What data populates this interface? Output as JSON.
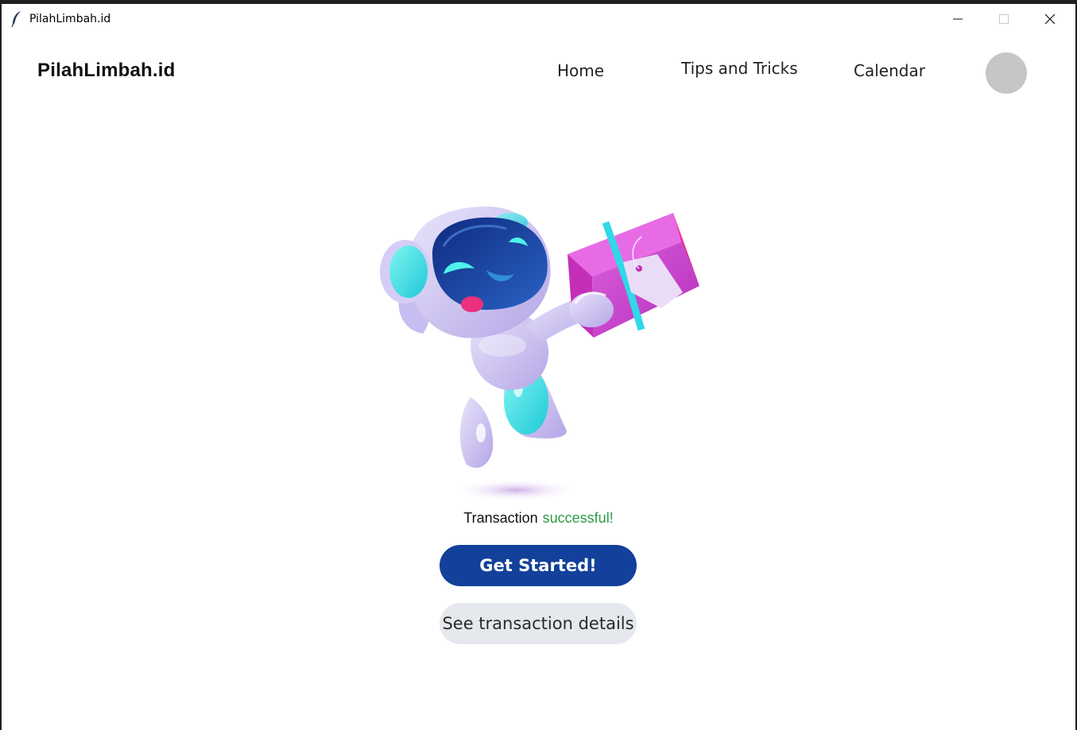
{
  "window": {
    "title": "PilahLimbah.id",
    "controls": [
      "minimize-icon",
      "maximize-icon",
      "close-icon"
    ]
  },
  "header": {
    "brand": "PilahLimbah.id",
    "nav": [
      {
        "label": "Home"
      },
      {
        "label": "Tips and Tricks"
      },
      {
        "label": "Calendar"
      }
    ]
  },
  "main": {
    "illustration_icon": "robot-holding-package",
    "status_label": "Transaction",
    "status_value": "successful!",
    "primary_button": "Get Started!",
    "secondary_button": "See transaction details"
  },
  "colors": {
    "primary": "#12409a",
    "success": "#2f9a47",
    "secondary_bg": "#e5e8ec",
    "avatar": "#c6c6c6"
  }
}
